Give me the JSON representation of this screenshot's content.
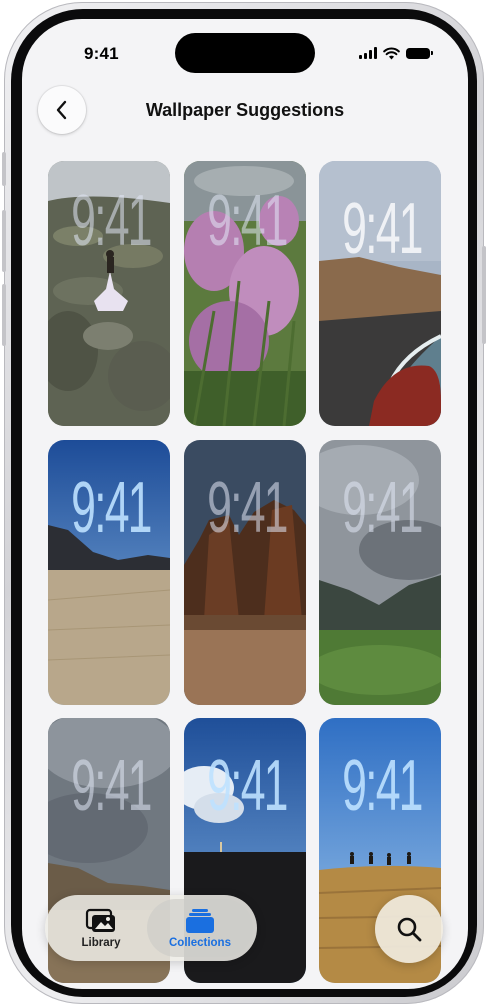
{
  "status_bar": {
    "time": "9:41"
  },
  "nav": {
    "title": "Wallpaper Suggestions"
  },
  "wallpapers": [
    {
      "clock": "9:41",
      "subject": "woman in white dress on mossy lava rocks"
    },
    {
      "clock": "9:41",
      "subject": "pink heather flowers"
    },
    {
      "clock": "9:41",
      "subject": "coastal cliff and black sand beach"
    },
    {
      "clock": "9:41",
      "subject": "dry lakebed with mountains"
    },
    {
      "clock": "9:41",
      "subject": "desert rock formations under night sky"
    },
    {
      "clock": "9:41",
      "subject": "green valley under cloudy sky"
    },
    {
      "clock": "9:41",
      "subject": "cloudy sky over hills"
    },
    {
      "clock": "9:41",
      "subject": "person walking on dark horizon"
    },
    {
      "clock": "9:41",
      "subject": "people running across golden field"
    }
  ],
  "tab_bar": {
    "library_label": "Library",
    "collections_label": "Collections",
    "active_tab": "Collections"
  },
  "colors": {
    "accent": "#1a6fe0",
    "screen_bg": "#f4f4f6"
  },
  "icons": {
    "back": "chevron-left-icon",
    "library": "photo-stack-icon",
    "collections": "collections-icon",
    "search": "magnifying-glass-icon"
  }
}
